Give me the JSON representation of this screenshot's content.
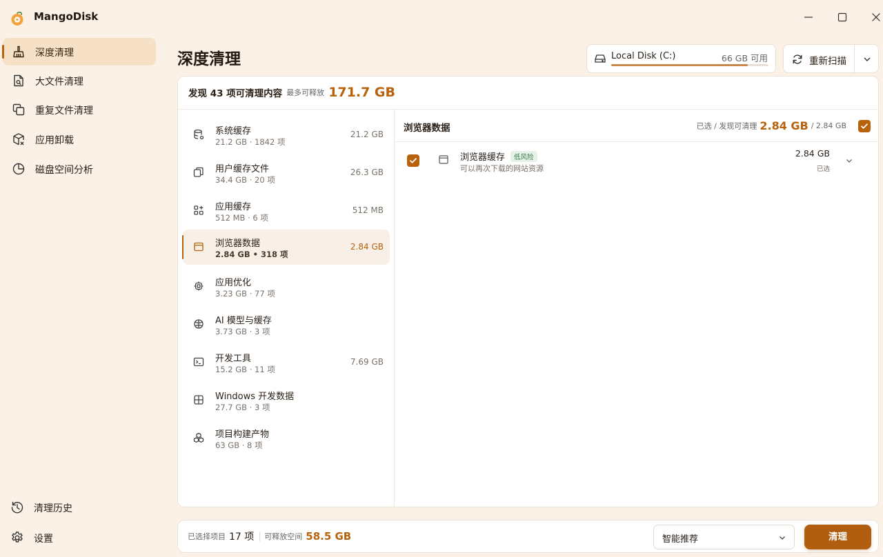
{
  "app": {
    "title": "MangoDisk"
  },
  "colors": {
    "accent": "#b8620e",
    "background": "#fbf1e6",
    "active_nav": "#f6e0c6",
    "low_risk_badge": "#e6f2e8"
  },
  "sidebar": {
    "items": [
      {
        "label": "深度清理",
        "icon": "broom-icon",
        "active": true
      },
      {
        "label": "大文件清理",
        "icon": "file-search-icon",
        "active": false
      },
      {
        "label": "重复文件清理",
        "icon": "duplicate-icon",
        "active": false
      },
      {
        "label": "应用卸载",
        "icon": "package-remove-icon",
        "active": false
      },
      {
        "label": "磁盘空间分析",
        "icon": "pie-chart-icon",
        "active": false
      }
    ],
    "bottom": [
      {
        "label": "清理历史",
        "icon": "history-icon"
      },
      {
        "label": "设置",
        "icon": "gear-icon"
      }
    ]
  },
  "header": {
    "title": "深度清理",
    "disk": {
      "name": "Local Disk (C:)",
      "free": "66 GB 可用",
      "used_fraction": 0.87
    },
    "rescan_label": "重新扫描"
  },
  "summary": {
    "text": "发现 43 项可清理内容",
    "sub": "最多可释放",
    "size": "171.7 GB"
  },
  "categories": [
    {
      "name": "系统缓存",
      "meta": "21.2 GB · 1842 项",
      "size": "21.2 GB",
      "icon": "database-icon",
      "active": false
    },
    {
      "name": "用户缓存文件",
      "meta": "34.4 GB · 20 项",
      "size": "26.3 GB",
      "icon": "copy-icon",
      "active": false
    },
    {
      "name": "应用缓存",
      "meta": "512 MB · 6 项",
      "size": "512 MB",
      "icon": "apps-icon",
      "active": false
    },
    {
      "name": "浏览器数据",
      "meta": "2.84 GB • 318 项",
      "size": "2.84 GB",
      "icon": "browser-icon",
      "active": true
    },
    {
      "name": "应用优化",
      "meta": "3.23 GB · 77 项",
      "size": "",
      "icon": "chip-icon",
      "active": false
    },
    {
      "name": "AI 模型与缓存",
      "meta": "3.73 GB · 3 项",
      "size": "",
      "icon": "brain-icon",
      "active": false
    },
    {
      "name": "开发工具",
      "meta": "15.2 GB · 11 项",
      "size": "7.69 GB",
      "icon": "terminal-icon",
      "active": false
    },
    {
      "name": "Windows 开发数据",
      "meta": "27.7 GB · 3 项",
      "size": "",
      "icon": "windows-icon",
      "active": false
    },
    {
      "name": "项目构建产物",
      "meta": "63 GB · 8 项",
      "size": "",
      "icon": "cubes-icon",
      "active": false
    }
  ],
  "detail": {
    "title": "浏览器数据",
    "selected_label": "已选 / 发现可清理",
    "selected_size": "2.84 GB",
    "total": "/ 2.84 GB",
    "all_checked": true,
    "items": [
      {
        "name": "浏览器缓存",
        "badge": "低风险",
        "desc": "可以再次下载的网站资源",
        "size": "2.84 GB",
        "state": "已选",
        "checked": true,
        "icon": "browser-icon"
      }
    ]
  },
  "bottom_bar": {
    "selected_label": "已选择项目",
    "selected_count": "17 项",
    "release_label": "可释放空间",
    "release_size": "58.5 GB",
    "mode": "智能推荐",
    "clean_label": "清理"
  }
}
